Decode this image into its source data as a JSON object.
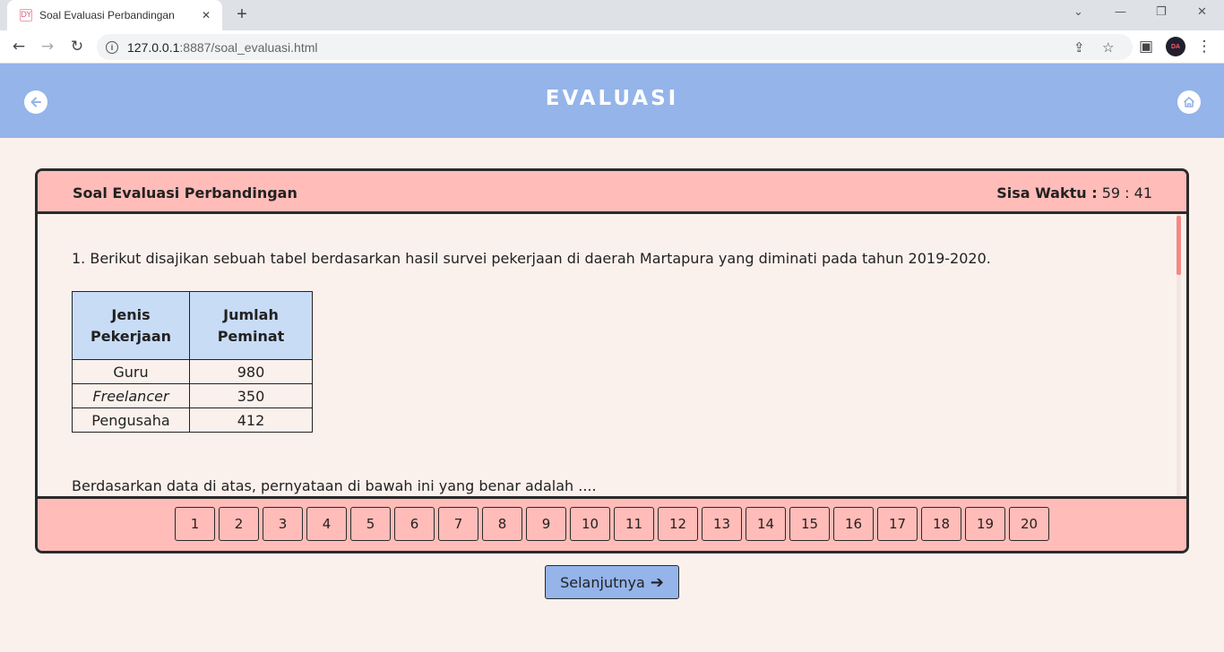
{
  "browser": {
    "tab_title": "Soal Evaluasi Perbandingan",
    "tab_favicon": "DY",
    "url_host": "127.0.0.1",
    "url_rest": ":8887/soal_evaluasi.html",
    "profile_initials": "DA"
  },
  "header": {
    "title": "EVALUASI",
    "back_icon": "arrow-left-icon",
    "home_icon": "home-icon",
    "accent_color": "#94b4ea"
  },
  "card": {
    "title": "Soal Evaluasi Perbandingan",
    "timer_label": "Sisa Waktu :",
    "timer_value": "59 : 41",
    "header_color": "#ffbcb8"
  },
  "question": {
    "text": "1. Berikut disajikan sebuah tabel berdasarkan hasil survei pekerjaan di daerah Martapura yang diminati pada tahun 2019-2020.",
    "table": {
      "headers": [
        "Jenis Pekerjaan",
        "Jumlah Peminat"
      ],
      "rows": [
        [
          "Guru",
          "980"
        ],
        [
          "Freelancer",
          "350"
        ],
        [
          "Pengusaha",
          "412"
        ]
      ]
    },
    "statement": "Berdasarkan data di atas, pernyataan di bawah ini yang benar adalah ...."
  },
  "pager": [
    "1",
    "2",
    "3",
    "4",
    "5",
    "6",
    "7",
    "8",
    "9",
    "10",
    "11",
    "12",
    "13",
    "14",
    "15",
    "16",
    "17",
    "18",
    "19",
    "20"
  ],
  "next_button": {
    "label": "Selanjutnya",
    "icon": "arrow-right-icon"
  }
}
